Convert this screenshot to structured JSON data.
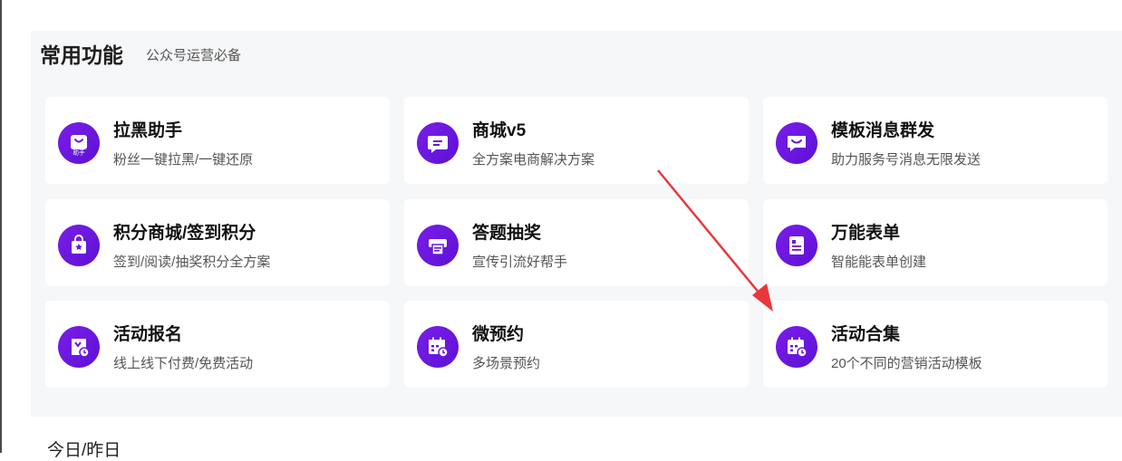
{
  "section": {
    "title": "常用功能",
    "subtitle": "公众号运营必备"
  },
  "cards": [
    {
      "title": "拉黑助手",
      "desc": "粉丝一键拉黑/一键还原",
      "icon": "shopping-bag-icon",
      "badge": "助手"
    },
    {
      "title": "商城v5",
      "desc": "全方案电商解决方案",
      "icon": "chat-bubble-icon"
    },
    {
      "title": "模板消息群发",
      "desc": "助力服务号消息无限发送",
      "icon": "message-smile-icon"
    },
    {
      "title": "积分商城/签到积分",
      "desc": "签到/阅读/抽奖积分全方案",
      "icon": "gift-bag-icon"
    },
    {
      "title": "答题抽奖",
      "desc": "宣传引流好帮手",
      "icon": "printer-icon"
    },
    {
      "title": "万能表单",
      "desc": "智能能表单创建",
      "icon": "form-icon"
    },
    {
      "title": "活动报名",
      "desc": "线上线下付费/免费活动",
      "icon": "signup-clock-icon"
    },
    {
      "title": "微预约",
      "desc": "多场景预约",
      "icon": "calendar-clock-icon"
    },
    {
      "title": "活动合集",
      "desc": "20个不同的营销活动模板",
      "icon": "calendar-clock-icon"
    }
  ],
  "bottom_label": "今日/昨日",
  "colors": {
    "accent": "#6a16e0",
    "panel_bg": "#f6f7f9",
    "arrow": "#e8383d"
  }
}
